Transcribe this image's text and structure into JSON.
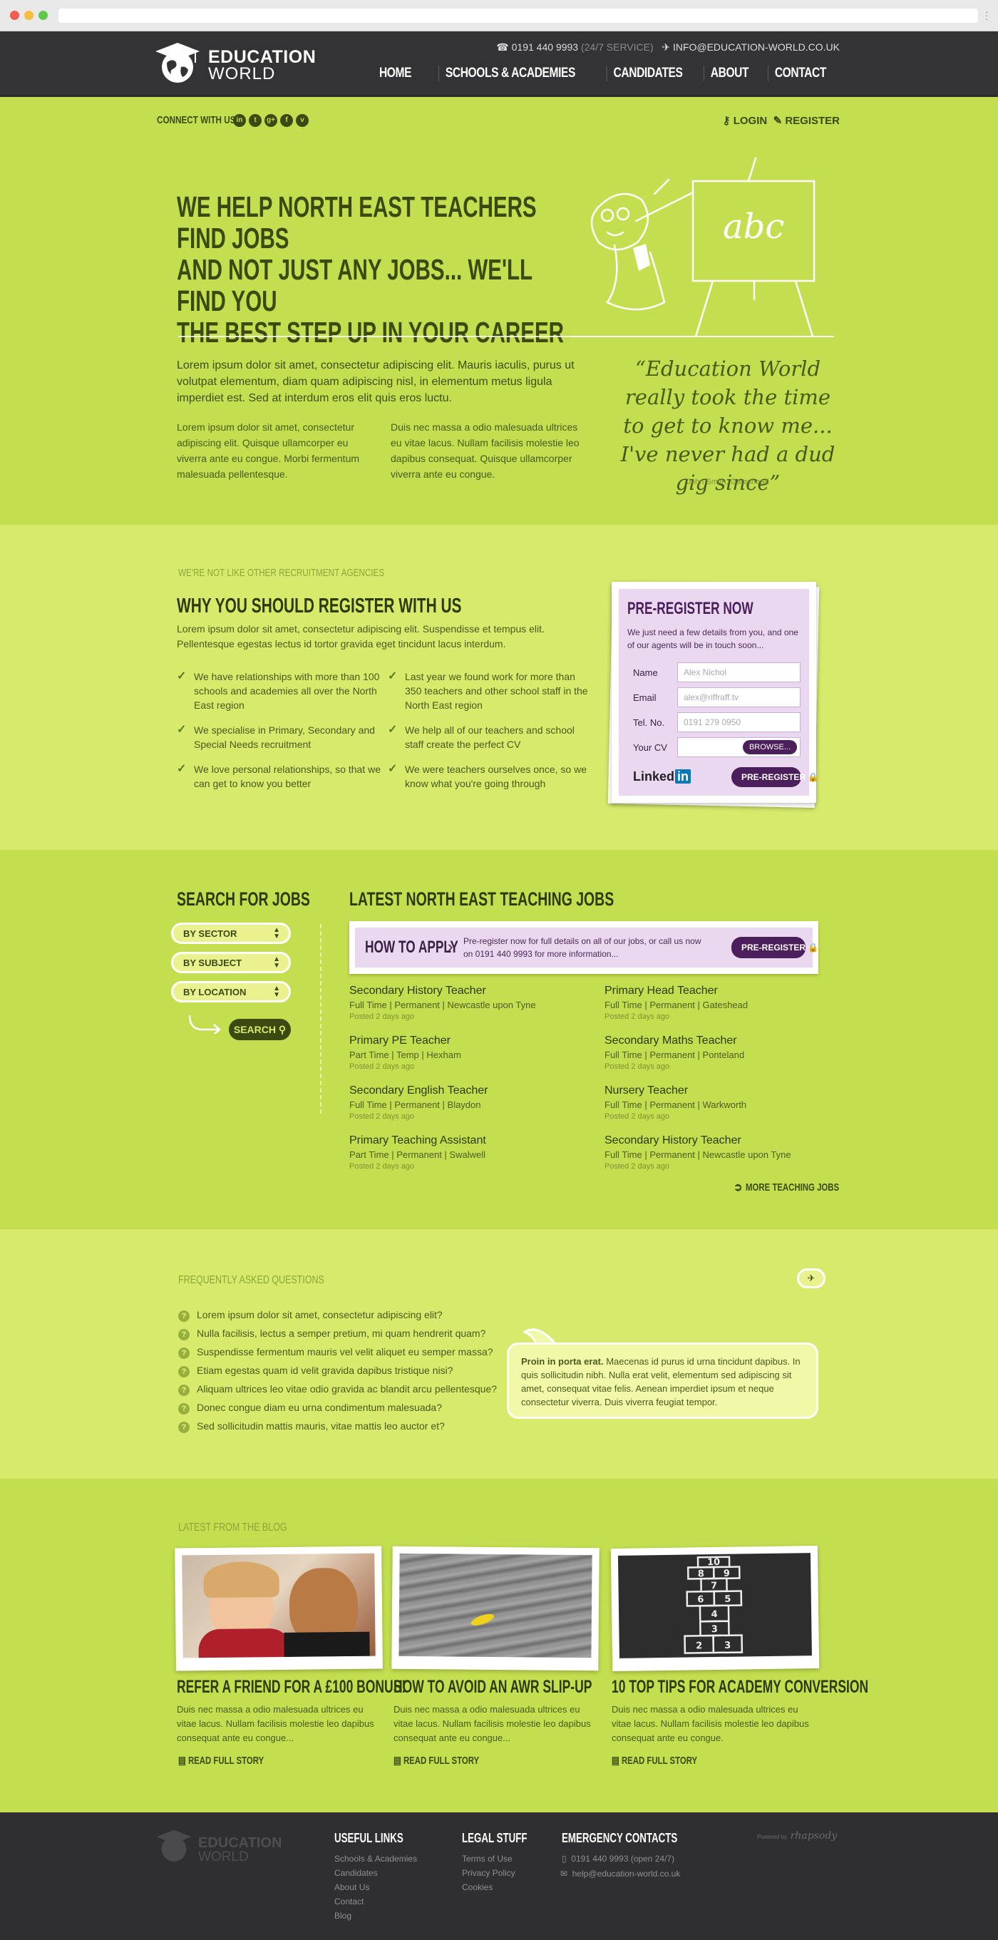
{
  "header": {
    "logo_line1": "EDUCATION",
    "logo_line2": "WORLD",
    "phone": "0191 440 9993",
    "phone_note": "(24/7 SERVICE)",
    "email": "INFO@EDUCATION-WORLD.CO.UK",
    "nav": [
      "HOME",
      "SCHOOLS & ACADEMIES",
      "CANDIDATES",
      "ABOUT",
      "CONTACT"
    ]
  },
  "topbar": {
    "connect_label": "CONNECT WITH US",
    "social_icons": [
      "linkedin-icon",
      "twitter-icon",
      "googleplus-icon",
      "facebook-icon",
      "vimeo-icon"
    ],
    "login": "LOGIN",
    "register": "REGISTER"
  },
  "hero": {
    "headline_lines": [
      "WE HELP NORTH EAST TEACHERS FIND JOBS",
      "AND NOT JUST ANY JOBS... WE'LL FIND YOU",
      "THE BEST STEP UP IN YOUR CAREER"
    ],
    "board_text": "abc",
    "lead": "Lorem ipsum dolor sit amet, consectetur adipiscing elit. Mauris iaculis, purus ut volutpat elementum, diam quam adipiscing nisl, in elementum metus ligula imperdiet est. Sed at interdum eros elit quis eros luctu.",
    "col1": "Lorem ipsum dolor sit amet, consectetur adipiscing elit. Quisque ullamcorper eu viverra ante eu congue. Morbi fermentum malesuada pellentesque.",
    "col2": "Duis nec massa a odio malesuada ultrices eu vitae lacus. Nullam facilisis molestie leo dapibus consequat. Quisque ullamcorper viverra ante eu congue.",
    "quote": "“Education World really took the time to get to know me... I've never had a dud gig since”",
    "quote_by": "John Smith, Gateshead"
  },
  "why": {
    "kicker": "WE'RE NOT LIKE OTHER RECRUITMENT AGENCIES",
    "title": "WHY YOU SHOULD REGISTER WITH US",
    "intro": "Lorem ipsum dolor sit amet, consectetur adipiscing elit. Suspendisse et tempus elit. Pellentesque egestas lectus id tortor gravida eget tincidunt lacus interdum.",
    "points": [
      "We have relationships with more than 100 schools and academies all over the North East region",
      "Last year we found work for more than 350 teachers and other school staff in the North East region",
      "We specialise in Primary, Secondary and Special Needs recruitment",
      "We help all of our teachers and school staff create the perfect CV",
      "We love personal relationships, so that we can get to know you better",
      "We were teachers ourselves once, so we know what you're going through"
    ]
  },
  "preregister": {
    "title": "PRE-REGISTER NOW",
    "text": "We just need a few details from you, and one of our agents will be in touch soon...",
    "name_label": "Name",
    "name_placeholder": "Alex Nichol",
    "email_label": "Email",
    "email_placeholder": "alex@riffraff.tv",
    "tel_label": "Tel. No.",
    "tel_placeholder": "0191 279 0950",
    "cv_label": "Your CV",
    "browse": "BROWSE...",
    "linkedin": "Linked",
    "linkedin_in": "in",
    "submit": "PRE-REGISTER"
  },
  "search": {
    "title": "SEARCH FOR JOBS",
    "selects": [
      "BY SECTOR",
      "BY SUBJECT",
      "BY LOCATION"
    ],
    "button": "SEARCH"
  },
  "jobs": {
    "title": "LATEST NORTH EAST TEACHING JOBS",
    "apply_title": "HOW TO APPLY",
    "apply_text": "Pre-register now for full details on all of our jobs, or call us now on 0191 440 9993 for more information...",
    "apply_button": "PRE-REGISTER",
    "list": [
      {
        "title": "Secondary History Teacher",
        "meta": "Full Time | Permanent | Newcastle upon Tyne",
        "date": "Posted 2 days ago"
      },
      {
        "title": "Primary Head Teacher",
        "meta": "Full Time | Permanent | Gateshead",
        "date": "Posted 2 days ago"
      },
      {
        "title": "Primary PE Teacher",
        "meta": "Part Time | Temp | Hexham",
        "date": "Posted 2 days ago"
      },
      {
        "title": "Secondary Maths Teacher",
        "meta": "Full Time | Permanent | Ponteland",
        "date": "Posted 2 days ago"
      },
      {
        "title": "Secondary English Teacher",
        "meta": "Full Time | Permanent | Blaydon",
        "date": "Posted 2 days ago"
      },
      {
        "title": "Nursery Teacher",
        "meta": "Full Time | Permanent | Warkworth",
        "date": "Posted 2 days ago"
      },
      {
        "title": "Primary Teaching Assistant",
        "meta": "Part Time | Permanent | Swalwell",
        "date": "Posted 2 days ago"
      },
      {
        "title": "Secondary History Teacher",
        "meta": "Full Time | Permanent | Newcastle upon Tyne",
        "date": "Posted 2 days ago"
      }
    ],
    "more": "MORE TEACHING JOBS"
  },
  "faq": {
    "title": "FREQUENTLY ASKED QUESTIONS",
    "questions": [
      "Lorem ipsum dolor sit amet, consectetur adipiscing elit?",
      "Nulla facilisis, lectus a semper pretium, mi quam hendrerit quam?",
      "Suspendisse fermentum mauris vel velit aliquet eu semper massa?",
      "Etiam egestas quam id velit gravida dapibus tristique nisi?",
      "Aliquam ultrices leo vitae odio gravida ac blandit arcu pellentesque?",
      "Donec congue diam eu urna condimentum malesuada?",
      "Sed sollicitudin mattis mauris, vitae mattis leo auctor et?"
    ],
    "answer_bold": "Proin in porta erat.",
    "answer": "Maecenas id purus id urna tincidunt dapibus. In quis sollicitudin nibh. Nulla erat velit, elementum sed adipiscing sit amet, consequat vitae felis. Aenean imperdiet ipsum et neque consectetur viverra. Duis viverra feugiat tempor."
  },
  "blog": {
    "title": "LATEST FROM THE BLOG",
    "posts": [
      {
        "title": "REFER A FRIEND FOR A £100 BONUS!",
        "text": "Duis nec massa a odio malesuada ultrices eu vitae lacus. Nullam facilisis molestie leo dapibus consequat ante eu congue...",
        "more": "READ FULL STORY"
      },
      {
        "title": "HOW TO AVOID AN AWR SLIP-UP",
        "text": "Duis nec massa a odio malesuada ultrices eu vitae lacus. Nullam facilisis molestie leo dapibus consequat ante eu congue...",
        "more": "READ FULL STORY"
      },
      {
        "title": "10 TOP TIPS FOR ACADEMY CONVERSION",
        "text": "Duis nec massa a odio malesuada ultrices eu vitae lacus. Nullam facilisis molestie leo dapibus consequat ante eu congue.",
        "more": "READ FULL STORY"
      }
    ],
    "hopscotch_numbers": [
      "10",
      "8",
      "9",
      "7",
      "6",
      "5",
      "4",
      "3",
      "2",
      "3"
    ]
  },
  "footer": {
    "logo_line1": "EDUCATION",
    "logo_line2": "WORLD",
    "useful_title": "USEFUL LINKS",
    "useful": [
      "Schools & Academies",
      "Candidates",
      "About Us",
      "Contact",
      "Blog"
    ],
    "legal_title": "LEGAL STUFF",
    "legal": [
      "Terms of Use",
      "Privacy Policy",
      "Cookies"
    ],
    "emergency_title": "EMERGENCY CONTACTS",
    "emergency_phone": "0191 440 9993 (open 24/7)",
    "emergency_email": "help@education-world.co.uk",
    "powered": "Powered by",
    "powered_brand": "rhapsody"
  },
  "colors": {
    "lime": "#c3de4f",
    "lime_light": "#d7ea6c",
    "dark": "#333335",
    "purple": "#4b1f5c",
    "lilac": "#e9d8f0"
  }
}
